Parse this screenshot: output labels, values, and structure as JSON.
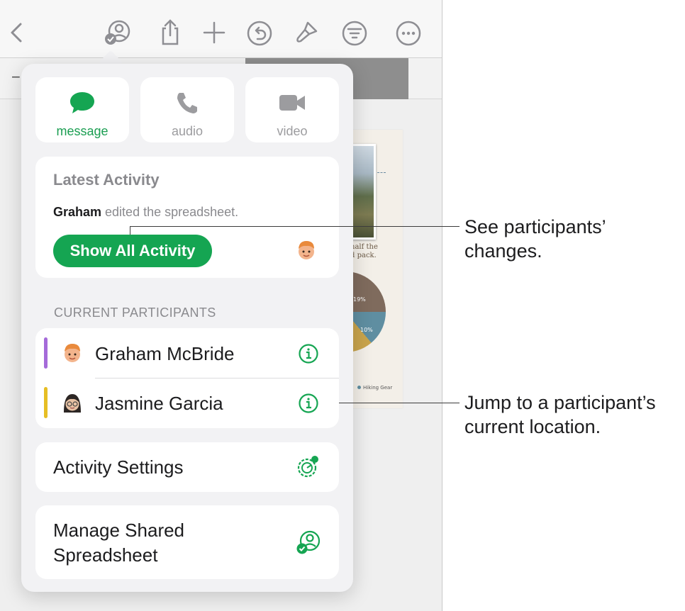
{
  "toolbar": {
    "icons": [
      "back-chevron-icon",
      "collaborate-icon",
      "share-icon",
      "add-icon",
      "undo-icon",
      "format-brush-icon",
      "organize-icon",
      "more-icon"
    ]
  },
  "colors": {
    "accent": "#15a552",
    "graham": "#a56bd9",
    "jasmine": "#e6be24"
  },
  "document": {
    "caption": "half the\nd pack.",
    "pie_labels": [
      "19%",
      "10%"
    ],
    "legend": "Hiking Gear"
  },
  "popover": {
    "comm": [
      {
        "label": "message",
        "icon": "message-bubble-icon",
        "active": true
      },
      {
        "label": "audio",
        "icon": "phone-icon",
        "active": false
      },
      {
        "label": "video",
        "icon": "video-camera-icon",
        "active": false
      }
    ],
    "latest_activity": {
      "title": "Latest Activity",
      "user": "Graham",
      "text": " edited the spreadsheet.",
      "button": "Show All Activity"
    },
    "participants_header": "CURRENT PARTICIPANTS",
    "participants": [
      {
        "name": "Graham McBride",
        "color": "#a56bd9"
      },
      {
        "name": "Jasmine Garcia",
        "color": "#e6be24"
      }
    ],
    "activity_settings": "Activity Settings",
    "manage_shared": "Manage Shared Spreadsheet"
  },
  "callouts": {
    "changes": "See participants’ changes.",
    "jump": "Jump to a participant’s current location."
  }
}
